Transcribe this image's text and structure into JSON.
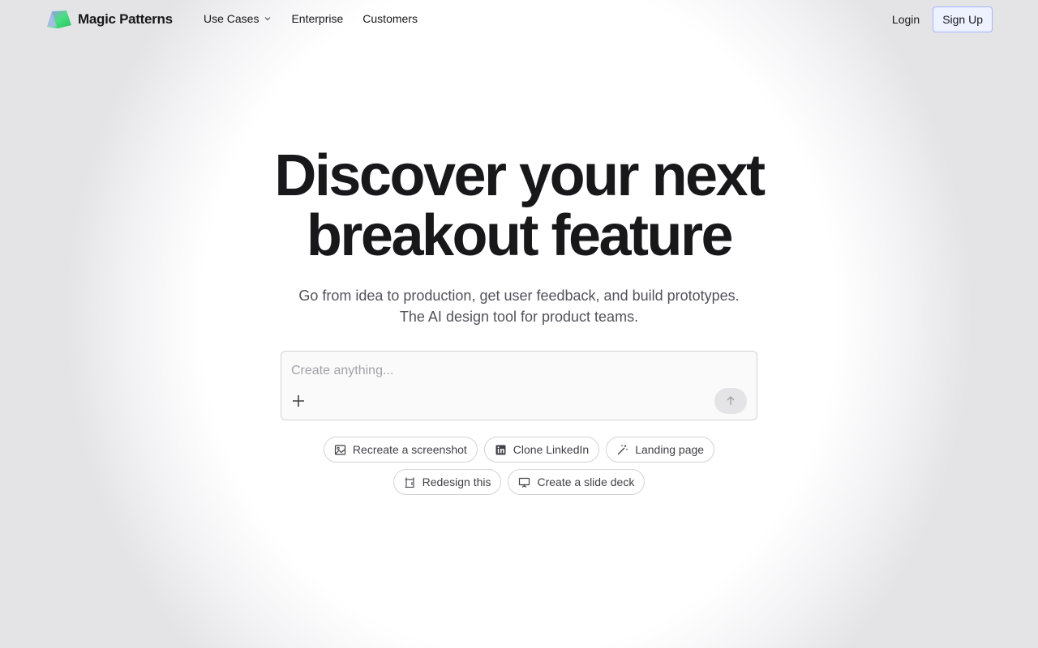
{
  "nav": {
    "brand": "Magic Patterns",
    "links": [
      {
        "label": "Use Cases",
        "has_dropdown": true,
        "icon": "chevron-down-icon"
      },
      {
        "label": "Enterprise"
      },
      {
        "label": "Customers"
      }
    ],
    "login_label": "Login",
    "signup_label": "Sign Up"
  },
  "hero": {
    "headline": "Discover your next breakout feature",
    "subtitle_line1": "Go from idea to production, get user feedback, and build prototypes.",
    "subtitle_line2": "The AI design tool for product teams."
  },
  "prompt": {
    "placeholder": "Create anything...",
    "value": "",
    "add_icon": "plus-icon",
    "send_icon": "arrow-up-icon"
  },
  "suggestions": {
    "row1": [
      {
        "label": "Recreate a screenshot",
        "icon": "image-icon"
      },
      {
        "label": "Clone LinkedIn",
        "icon": "linkedin-icon"
      },
      {
        "label": "Landing page",
        "icon": "magic-wand-icon"
      }
    ],
    "row2": [
      {
        "label": "Redesign this",
        "icon": "redesign-icon"
      },
      {
        "label": "Create a slide deck",
        "icon": "presentation-icon"
      }
    ]
  },
  "colors": {
    "signup_border": "#a5b4fc",
    "signup_bg": "#eef2ff",
    "text": "#18181b",
    "muted": "#52525b"
  }
}
